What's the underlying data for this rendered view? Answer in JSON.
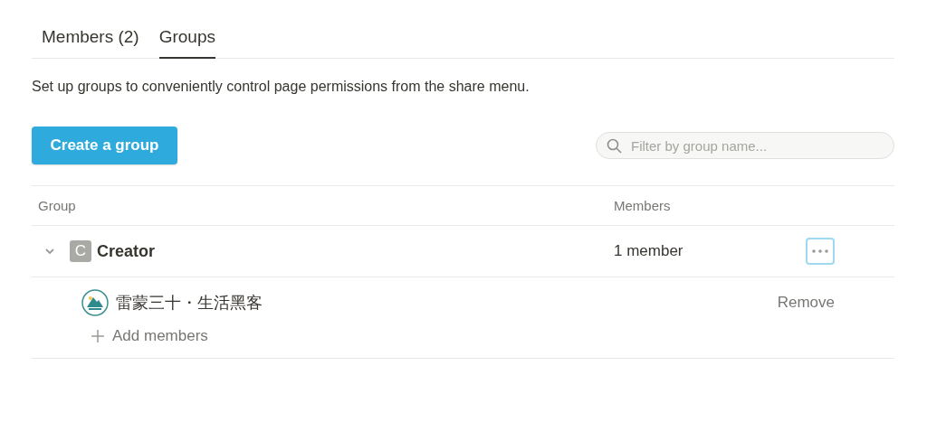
{
  "tabs": [
    {
      "label": "Members (2)",
      "selected": false
    },
    {
      "label": "Groups",
      "selected": true
    }
  ],
  "description": "Set up groups to conveniently control page permissions from the share menu.",
  "create_button": "Create a group",
  "search": {
    "placeholder": "Filter by group name..."
  },
  "table": {
    "columns": [
      "Group",
      "Members"
    ],
    "groups": [
      {
        "initial": "C",
        "name": "Creator",
        "member_count": "1 member",
        "expanded": true,
        "members": [
          {
            "name": "雷蒙三十・生活黑客",
            "action": "Remove"
          }
        ],
        "add_label": "Add members"
      }
    ]
  }
}
